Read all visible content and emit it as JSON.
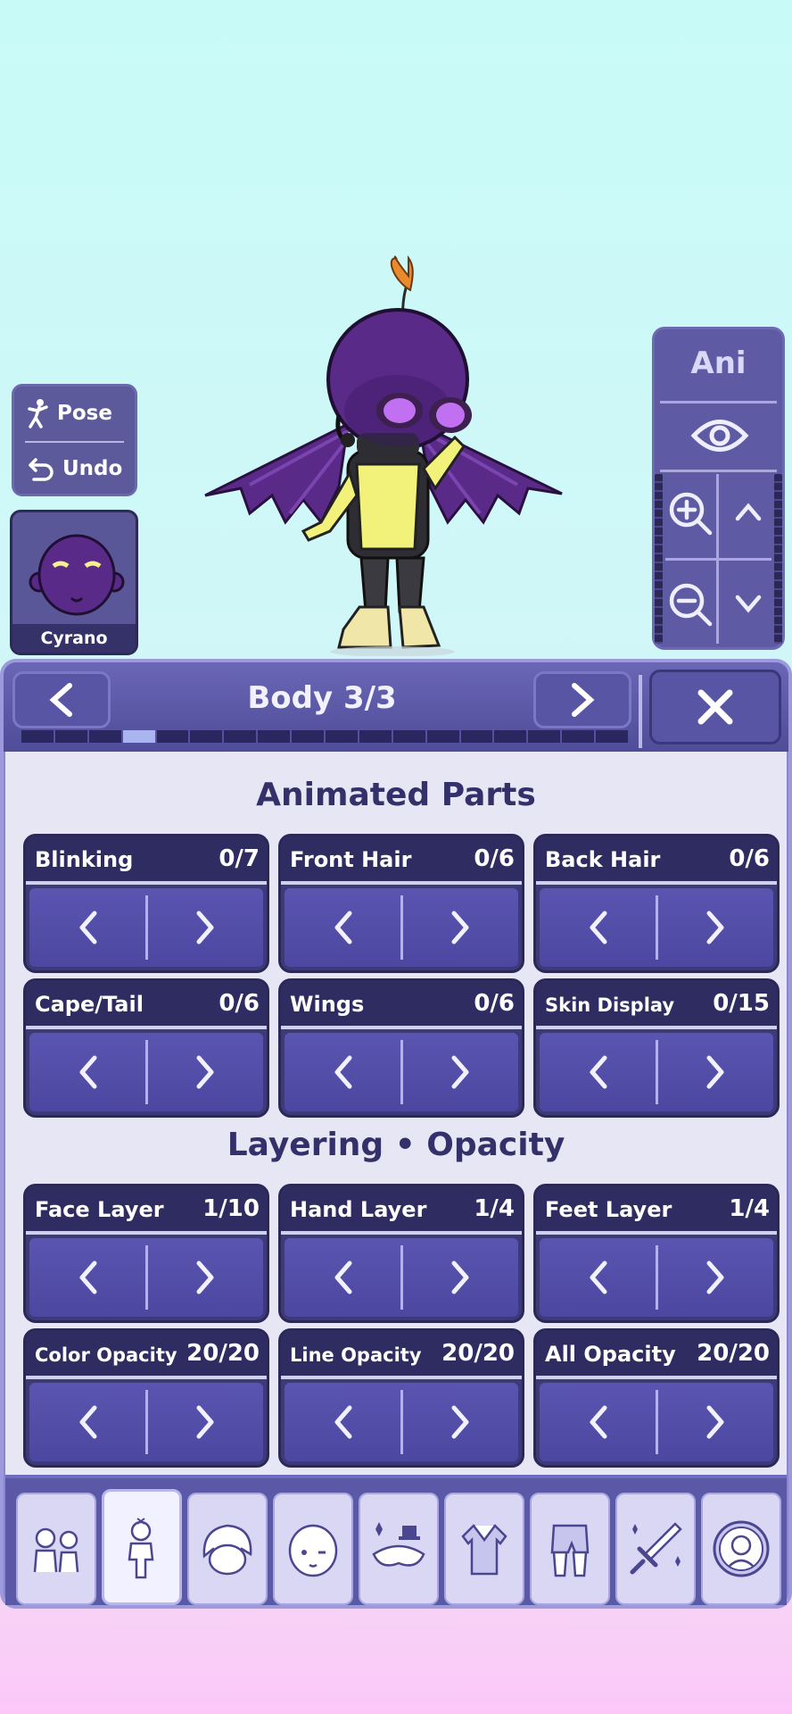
{
  "left_panel": {
    "pose_label": "Pose",
    "undo_label": "Undo",
    "character_name": "Cyrano"
  },
  "right_panel": {
    "ani_label": "Ani",
    "icons": [
      "eye-icon",
      "zoom-in-icon",
      "chevron-up-icon",
      "zoom-out-icon",
      "chevron-down-icon"
    ]
  },
  "header": {
    "title": "Body 3/3",
    "prev_label": "<",
    "next_label": ">",
    "close_label": "X",
    "page_indicator": {
      "segments": 18,
      "active_index": 3
    }
  },
  "sections": {
    "animated_title": "Animated Parts",
    "layering_title": "Layering • Opacity"
  },
  "animated": [
    {
      "label": "Blinking",
      "value": "0/7"
    },
    {
      "label": "Front Hair",
      "value": "0/6"
    },
    {
      "label": "Back Hair",
      "value": "0/6"
    },
    {
      "label": "Cape/Tail",
      "value": "0/6"
    },
    {
      "label": "Wings",
      "value": "0/6"
    },
    {
      "label": "Skin Display",
      "value": "0/15"
    }
  ],
  "layering": [
    {
      "label": "Face Layer",
      "value": "1/10"
    },
    {
      "label": "Hand Layer",
      "value": "1/4"
    },
    {
      "label": "Feet Layer",
      "value": "1/4"
    },
    {
      "label": "Color Opacity",
      "value": "20/20"
    },
    {
      "label": "Line Opacity",
      "value": "20/20"
    },
    {
      "label": "All Opacity",
      "value": "20/20"
    }
  ],
  "tabs": [
    {
      "name": "characters-tab",
      "icon": "characters-icon"
    },
    {
      "name": "body-tab",
      "icon": "body-icon",
      "active": true
    },
    {
      "name": "hair-tab",
      "icon": "hair-icon"
    },
    {
      "name": "face-tab",
      "icon": "face-icon"
    },
    {
      "name": "accessories-tab",
      "icon": "accessories-icon"
    },
    {
      "name": "top-tab",
      "icon": "shirt-icon"
    },
    {
      "name": "bottom-tab",
      "icon": "pants-icon"
    },
    {
      "name": "props-tab",
      "icon": "sword-icon"
    },
    {
      "name": "profile-tab",
      "icon": "profile-icon"
    }
  ],
  "colors": {
    "accent": "#4c47a0",
    "panel": "#8a87cf",
    "card_header": "#2f2c62",
    "active_page": "#a9b4f0"
  }
}
